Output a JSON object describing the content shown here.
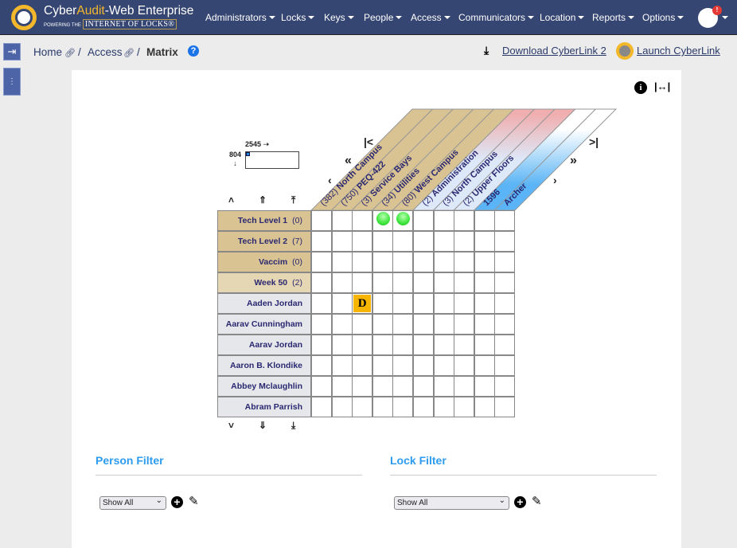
{
  "app": {
    "brand_prefix": "Cyber",
    "brand_accent": "Audit",
    "brand_suffix": "-Web Enterprise",
    "tagline_small": "POWERING THE",
    "tagline_big": "INTERNET OF LOCKS®"
  },
  "nav": {
    "items": [
      "Administrators",
      "Locks",
      "Keys",
      "People",
      "Access",
      "Communicators",
      "Location",
      "Reports",
      "Options"
    ],
    "badge": "!"
  },
  "breadcrumb": {
    "home": "Home",
    "access": "Access",
    "current": "Matrix",
    "sep": "/"
  },
  "actions": {
    "download": "Download CyberLink 2",
    "launch": "Launch CyberLink"
  },
  "matrix": {
    "total_locks": "2545",
    "total_people": "804",
    "columns": [
      {
        "count": "(382)",
        "name": "North Campus",
        "type": "group"
      },
      {
        "count": "(750)",
        "name": "PEQ-422",
        "type": "group"
      },
      {
        "count": "(3)",
        "name": "Service Bays",
        "type": "group"
      },
      {
        "count": "(34)",
        "name": "Utilities",
        "type": "group"
      },
      {
        "count": "(80)",
        "name": "West Campus",
        "type": "group"
      },
      {
        "count": "(2)",
        "name": "Administration",
        "type": "area"
      },
      {
        "count": "(3)",
        "name": "North Campus",
        "type": "area"
      },
      {
        "count": "(2)",
        "name": "Upper Floors",
        "type": "area"
      },
      {
        "count": "",
        "name": "1596",
        "type": "lock"
      },
      {
        "count": "",
        "name": "Archer",
        "type": "lock"
      }
    ],
    "rows": [
      {
        "name": "Tech Level 1",
        "count": "(0)",
        "type": "group"
      },
      {
        "name": "Tech Level 2",
        "count": "(7)",
        "type": "group"
      },
      {
        "name": "Vaccim",
        "count": "(0)",
        "type": "group"
      },
      {
        "name": "Week 50",
        "count": "(2)",
        "type": "group2"
      },
      {
        "name": "Aaden Jordan",
        "count": "",
        "type": "person"
      },
      {
        "name": "Aarav Cunningham",
        "count": "",
        "type": "person"
      },
      {
        "name": "Aarav Jordan",
        "count": "",
        "type": "person"
      },
      {
        "name": "Aaron B. Klondike",
        "count": "",
        "type": "person"
      },
      {
        "name": "Abbey Mclaughlin",
        "count": "",
        "type": "person"
      },
      {
        "name": "Abram Parrish",
        "count": "",
        "type": "person"
      }
    ],
    "marks": [
      {
        "row": 0,
        "col": 3,
        "kind": "green"
      },
      {
        "row": 0,
        "col": 4,
        "kind": "green"
      },
      {
        "row": 4,
        "col": 2,
        "kind": "D"
      }
    ],
    "colors": {
      "group": "#d9c393",
      "group2": "#e6d7b4",
      "person": "#e6e7eb",
      "mark_d": "#f7b500",
      "mark_green": "#3ee63e"
    }
  },
  "filters": {
    "person": {
      "title": "Person Filter",
      "value": "Show All"
    },
    "lock": {
      "title": "Lock Filter",
      "value": "Show All"
    }
  }
}
